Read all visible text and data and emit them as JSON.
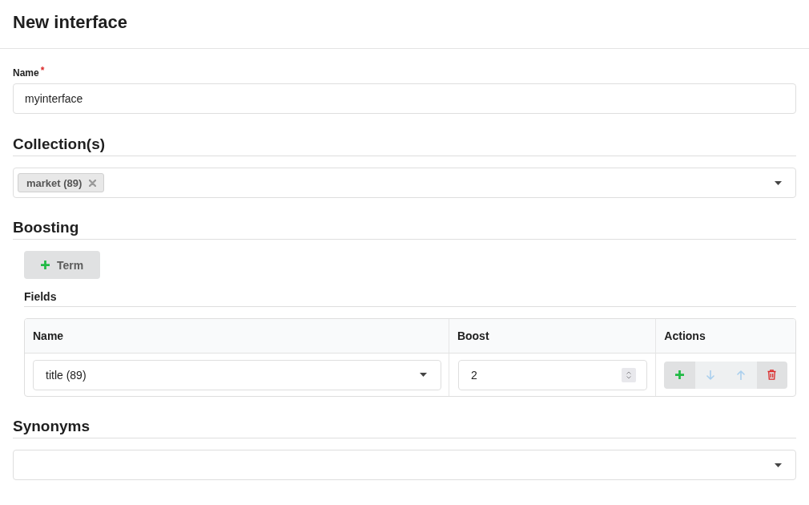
{
  "header": {
    "title": "New interface"
  },
  "name_field": {
    "label": "Name",
    "required_mark": "*",
    "value": "myinterface"
  },
  "collections": {
    "heading": "Collection(s)",
    "tags": [
      "market (89)"
    ]
  },
  "boosting": {
    "heading": "Boosting",
    "term_button": "Term",
    "fields": {
      "heading": "Fields",
      "columns": [
        "Name",
        "Boost",
        "Actions"
      ],
      "rows": [
        {
          "name": "title (89)",
          "boost": "2",
          "actions": [
            {
              "kind": "add",
              "disabled": false
            },
            {
              "kind": "down",
              "disabled": true
            },
            {
              "kind": "up",
              "disabled": true
            },
            {
              "kind": "delete",
              "disabled": false
            }
          ]
        }
      ]
    }
  },
  "synonyms": {
    "heading": "Synonyms"
  }
}
